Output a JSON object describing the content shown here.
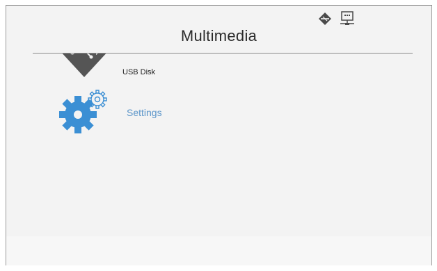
{
  "header": {
    "title": "Multimedia",
    "status_icons": [
      "network-diamond-icon",
      "ethernet-monitor-icon"
    ]
  },
  "menu": {
    "items": [
      {
        "label": "USB Disk",
        "icon": "usb-disk-icon",
        "selected": false
      },
      {
        "label": "Settings",
        "icon": "settings-gear-icon",
        "selected": true
      }
    ]
  },
  "colors": {
    "background": "#f3f3f3",
    "selected_text": "#5b95c9",
    "gear_blue": "#3b8fd4",
    "icon_dark": "#555555"
  }
}
